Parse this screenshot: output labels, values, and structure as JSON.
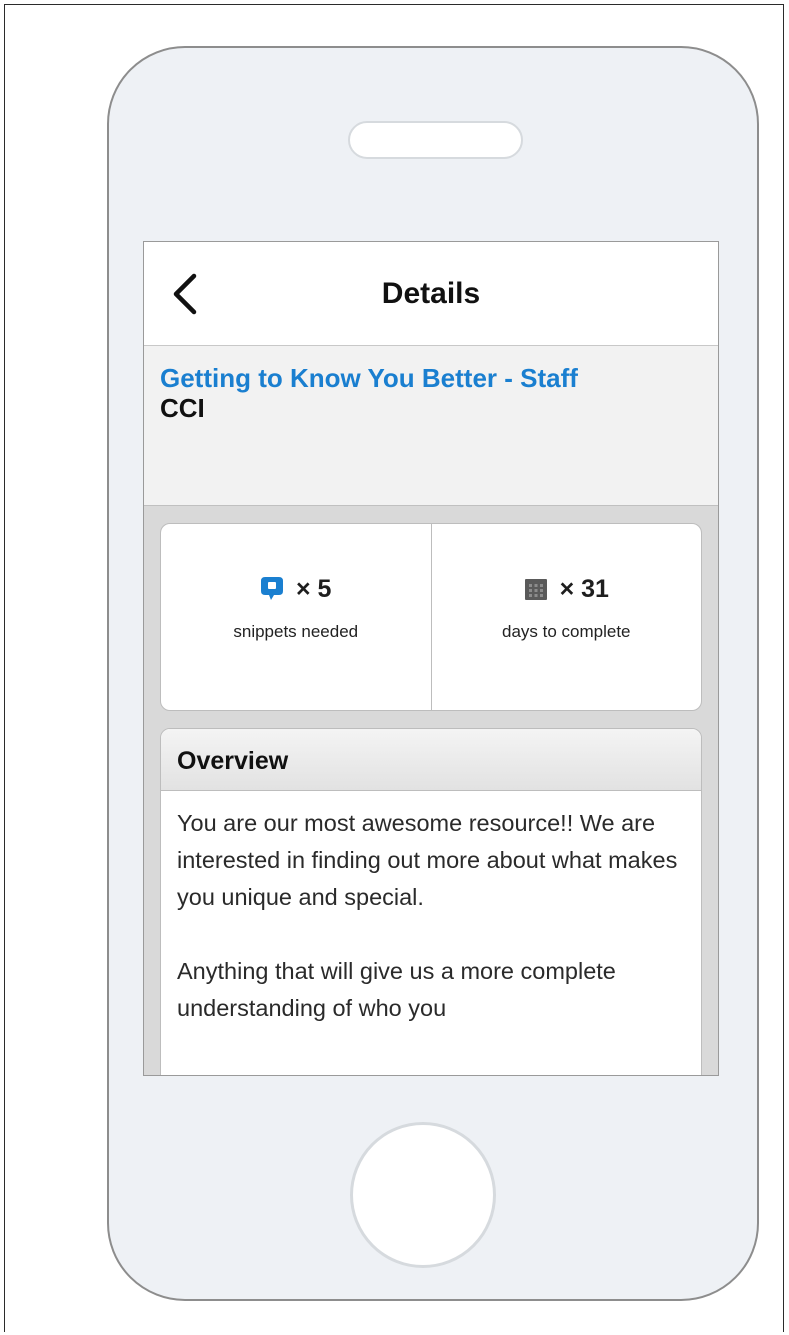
{
  "nav": {
    "back_icon": "chevron-left-icon",
    "title": "Details"
  },
  "item": {
    "title": "Getting to Know You Better - Staff",
    "organization": "CCI"
  },
  "stats": {
    "snippets": {
      "icon": "speech-bubble-icon",
      "icon_color": "#1a7fd0",
      "count": "× 5",
      "label": "snippets needed"
    },
    "days": {
      "icon": "calendar-icon",
      "icon_color": "#5a5a5a",
      "count": "× 31",
      "label": "days to complete"
    }
  },
  "overview": {
    "heading": "Overview",
    "paragraphs": [
      "You are our most awesome resource!! We are interested in finding out more about what makes you unique and special.",
      "Anything that will give us a more complete understanding of who you"
    ]
  },
  "colors": {
    "link": "#1a7fd0",
    "phone_body": "#eef1f5",
    "screen_background": "#d9d9d9"
  }
}
